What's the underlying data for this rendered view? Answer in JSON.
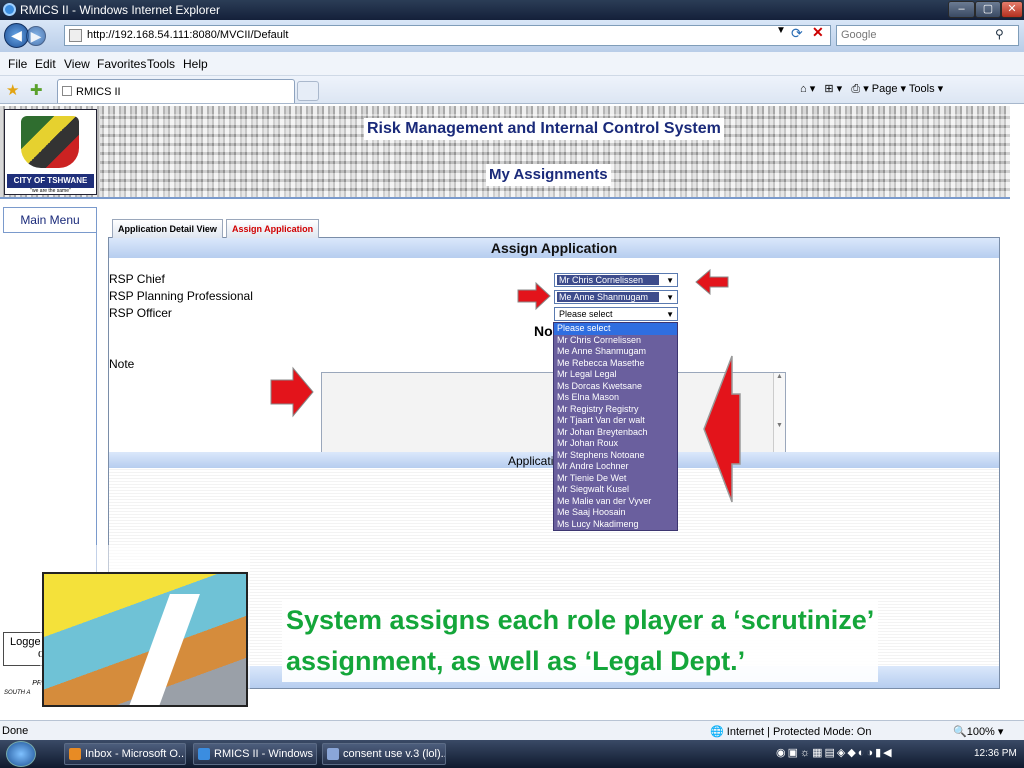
{
  "window": {
    "title": "RMICS II - Windows Internet Explorer",
    "url": "http://192.168.54.111:8080/MVCII/Default",
    "search_placeholder": "Google",
    "tab_title": "RMICS II",
    "menu": [
      "File",
      "Edit",
      "View",
      "Favorites",
      "Tools",
      "Help"
    ],
    "command_bar": "Page ▾ Tools ▾"
  },
  "header": {
    "logo_name": "CITY OF TSHWANE",
    "logo_motto": "\"we are the same\"",
    "system_title": "Risk Management and Internal Control System",
    "page_title": "My Assignments"
  },
  "sidebar": {
    "main_menu": "Main Menu",
    "logged_in": "Logge",
    "logged_in_2": "d",
    "footer_1": "PR",
    "footer_2": "SOUTH A"
  },
  "tabs": [
    {
      "label": "Application Detail View",
      "active": false
    },
    {
      "label": "Assign Application",
      "active": true
    }
  ],
  "assign": {
    "heading": "Assign Application",
    "roles": [
      {
        "label": "RSP Chief",
        "selected": "Mr Chris Cornelissen"
      },
      {
        "label": "RSP Planning Professional",
        "selected": "Me Anne Shanmugam"
      },
      {
        "label": "RSP Officer",
        "selected": "Please select"
      }
    ],
    "note_heading": "No",
    "note_label": "Note",
    "application_label": "Applicati"
  },
  "dropdown_options": [
    "Please select",
    "Mr Chris Cornelissen",
    "Me Anne Shanmugam",
    "Me Rebecca Masethe",
    "Mr Legal Legal",
    "Ms Dorcas Kwetsane",
    "Ms Elna Mason",
    "Mr Registry Registry",
    "Mr Tjaart Van der walt",
    "Mr Johan Breytenbach",
    "Mr Johan Roux",
    "Mr Stephens Notoane",
    "Mr Andre Lochner",
    "Mr Tienie De Wet",
    "Mr Siegwalt Kusel",
    "Me Malie van der Vyver",
    "Me Saaj Hoosain",
    "Ms Lucy Nkadimeng"
  ],
  "caption": {
    "line1": "System assigns each role player a ‘scrutinize’",
    "line2": "assignment, as well as ‘Legal Dept.’"
  },
  "status": {
    "left": "Done",
    "zone": "Internet | Protected Mode: On",
    "zoom": "100%"
  },
  "taskbar": {
    "items": [
      "Inbox - Microsoft O...",
      "RMICS II - Windows ...",
      "consent use v.3 (lol)..."
    ],
    "clock": "12:36 PM"
  },
  "colors": {
    "caption": "#14a63a",
    "arrow": "#e3141b",
    "title_blue": "#1a2a7a"
  }
}
